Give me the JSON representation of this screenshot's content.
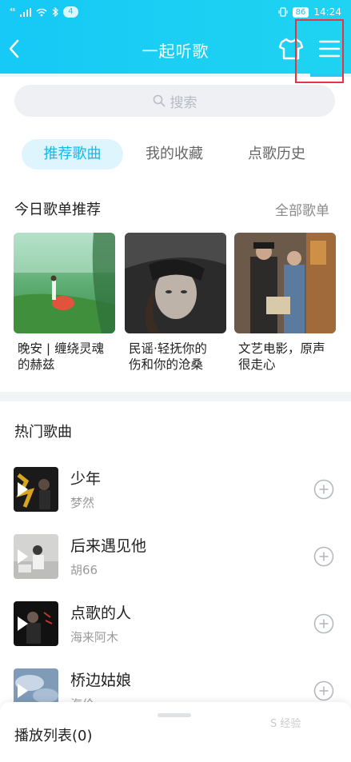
{
  "status_bar": {
    "signal": "⁴⁶",
    "notification_count": "4",
    "battery": "86",
    "time": "14:24"
  },
  "header": {
    "title": "一起听歌",
    "accent_color": "#18c4f2"
  },
  "search": {
    "placeholder": "搜索"
  },
  "tabs": [
    {
      "label": "推荐歌曲",
      "active": true
    },
    {
      "label": "我的收藏",
      "active": false
    },
    {
      "label": "点歌历史",
      "active": false
    }
  ],
  "daily_section": {
    "title": "今日歌单推荐",
    "link": "全部歌单",
    "cards": [
      {
        "caption_line1": "晚安 | 缠绕灵魂",
        "caption_line2": "的赫兹"
      },
      {
        "caption_line1": "民谣·轻抚你的",
        "caption_line2": "伤和你的沧桑"
      },
      {
        "caption_line1": "文艺电影，原声",
        "caption_line2": "很走心"
      }
    ]
  },
  "hot_section": {
    "title": "热门歌曲",
    "songs": [
      {
        "name": "少年",
        "artist": "梦然"
      },
      {
        "name": "后来遇见他",
        "artist": "胡66"
      },
      {
        "name": "点歌的人",
        "artist": "海来阿木"
      },
      {
        "name": "桥边姑娘",
        "artist": "海伦"
      }
    ]
  },
  "bottom_bar": {
    "label": "播放列表(0)",
    "watermark": "S 经验"
  }
}
